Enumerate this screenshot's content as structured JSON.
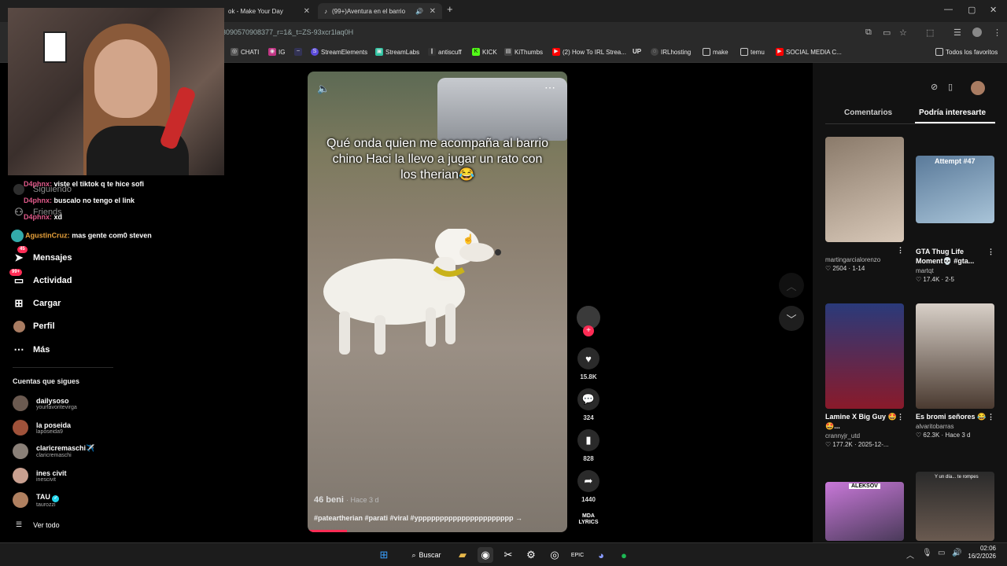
{
  "browser": {
    "tabs": [
      {
        "label": "ok - Make Your Day",
        "close": "✕"
      },
      {
        "label": "(99+)Aventura en el barrio",
        "close": "✕"
      }
    ],
    "new_tab": "+",
    "url": "3090570908377_r=1&_t=ZS-93xcr1laq0H",
    "bookmarks": [
      "CHATI",
      "IG",
      "StreamElements",
      "StreamLabs",
      "antiscuff",
      "KICK",
      "KiThumbs",
      "(2) How To IRL Strea...",
      "IRLhosting",
      "make",
      "temu",
      "SOCIAL MEDIA C..."
    ],
    "all_bookmarks": "Todos los favoritos",
    "window_controls": [
      "—",
      "▢",
      "✕"
    ]
  },
  "chat": [
    {
      "user": "D4phnx:",
      "msg": "viste el tiktok q te hice sofi"
    },
    {
      "user": "D4phnx:",
      "msg": "buscalo no tengo el link"
    },
    {
      "user": "D4phnx:",
      "msg": "xd"
    },
    {
      "user": "AgustinCruz:",
      "msg": "mas gente com0 steven"
    }
  ],
  "sidebar": {
    "items": [
      {
        "label": "Siguiendo",
        "icon": "people-icon"
      },
      {
        "label": "Friends",
        "icon": "friends-icon"
      },
      {
        "label": "Mensajes",
        "icon": "send-icon",
        "badge": "45"
      },
      {
        "label": "Actividad",
        "icon": "inbox-icon",
        "badge": "99+"
      },
      {
        "label": "Cargar",
        "icon": "plus-square-icon"
      },
      {
        "label": "Perfil",
        "icon": "avatar-icon"
      },
      {
        "label": "Más",
        "icon": "more-icon"
      }
    ],
    "following_title": "Cuentas que sigues",
    "following": [
      {
        "name": "dailysoso",
        "handle": "yourfavoritevirga",
        "color": "#6b5a50"
      },
      {
        "name": "la poseida",
        "handle": "laposeida9",
        "color": "#a0523a"
      },
      {
        "name": "claricremaschi✈️",
        "handle": "claricremaschi",
        "color": "#8a8078"
      },
      {
        "name": "ines civit",
        "handle": "inescivit",
        "color": "#c9a090"
      },
      {
        "name": "TAU",
        "handle": "taurozzi",
        "color": "#b08060"
      }
    ],
    "see_all": "Ver todo"
  },
  "video": {
    "caption": "Qué onda quien me acompaña al barrio chino Haci la llevo a jugar un rato con los therian😂",
    "author": "46 beni",
    "time": "· Hace 3 d",
    "tags": "#pateartherian #parati #viral #ypppppppppppppppppppppp →",
    "progress": 0.15,
    "likes": "15.8K",
    "comments": "324",
    "saves": "828",
    "shares": "1440",
    "lyrics": "MDA LYRICS"
  },
  "right_panel": {
    "tabs": [
      "Comentarios",
      "Podría interesarte"
    ],
    "cards": [
      {
        "title": "",
        "author": "martingarcialorenzo",
        "likes": "2504",
        "date": "1-14",
        "colors": [
          "#8a7a6a",
          "#d8c8b8"
        ]
      },
      {
        "title": "GTA Thug Life Moment💀 #gta...",
        "author": "martqt",
        "likes": "17.4K",
        "date": "2-5",
        "colors": [
          "#5a7a9a",
          "#a9c4d8"
        ],
        "overlay": "Attempt #47"
      },
      {
        "title": "Lamine X Big Guy 🤩🤩...",
        "author": "crannyjr_utd",
        "likes": "177.2K",
        "date": "2025-12-...",
        "colors": [
          "#2a3a7a",
          "#8a1a2a"
        ]
      },
      {
        "title": "Es bromi señores 😂",
        "author": "alvaritobarras",
        "likes": "62.3K",
        "date": "Hace 3 d",
        "colors": [
          "#d8d0c8",
          "#4a3a30"
        ]
      },
      {
        "title": "",
        "author": "",
        "likes": "",
        "date": "",
        "colors": [
          "#c878d8",
          "#4a3a5a"
        ],
        "overlay": "ALEKSOV"
      },
      {
        "title": "",
        "author": "",
        "likes": "",
        "date": "",
        "colors": [
          "#2a2a2a",
          "#6a5a50"
        ],
        "overlay": "Y un día... te rompes"
      }
    ]
  },
  "taskbar": {
    "search": "Buscar",
    "time": "02:06",
    "date": "16/2/2026"
  }
}
